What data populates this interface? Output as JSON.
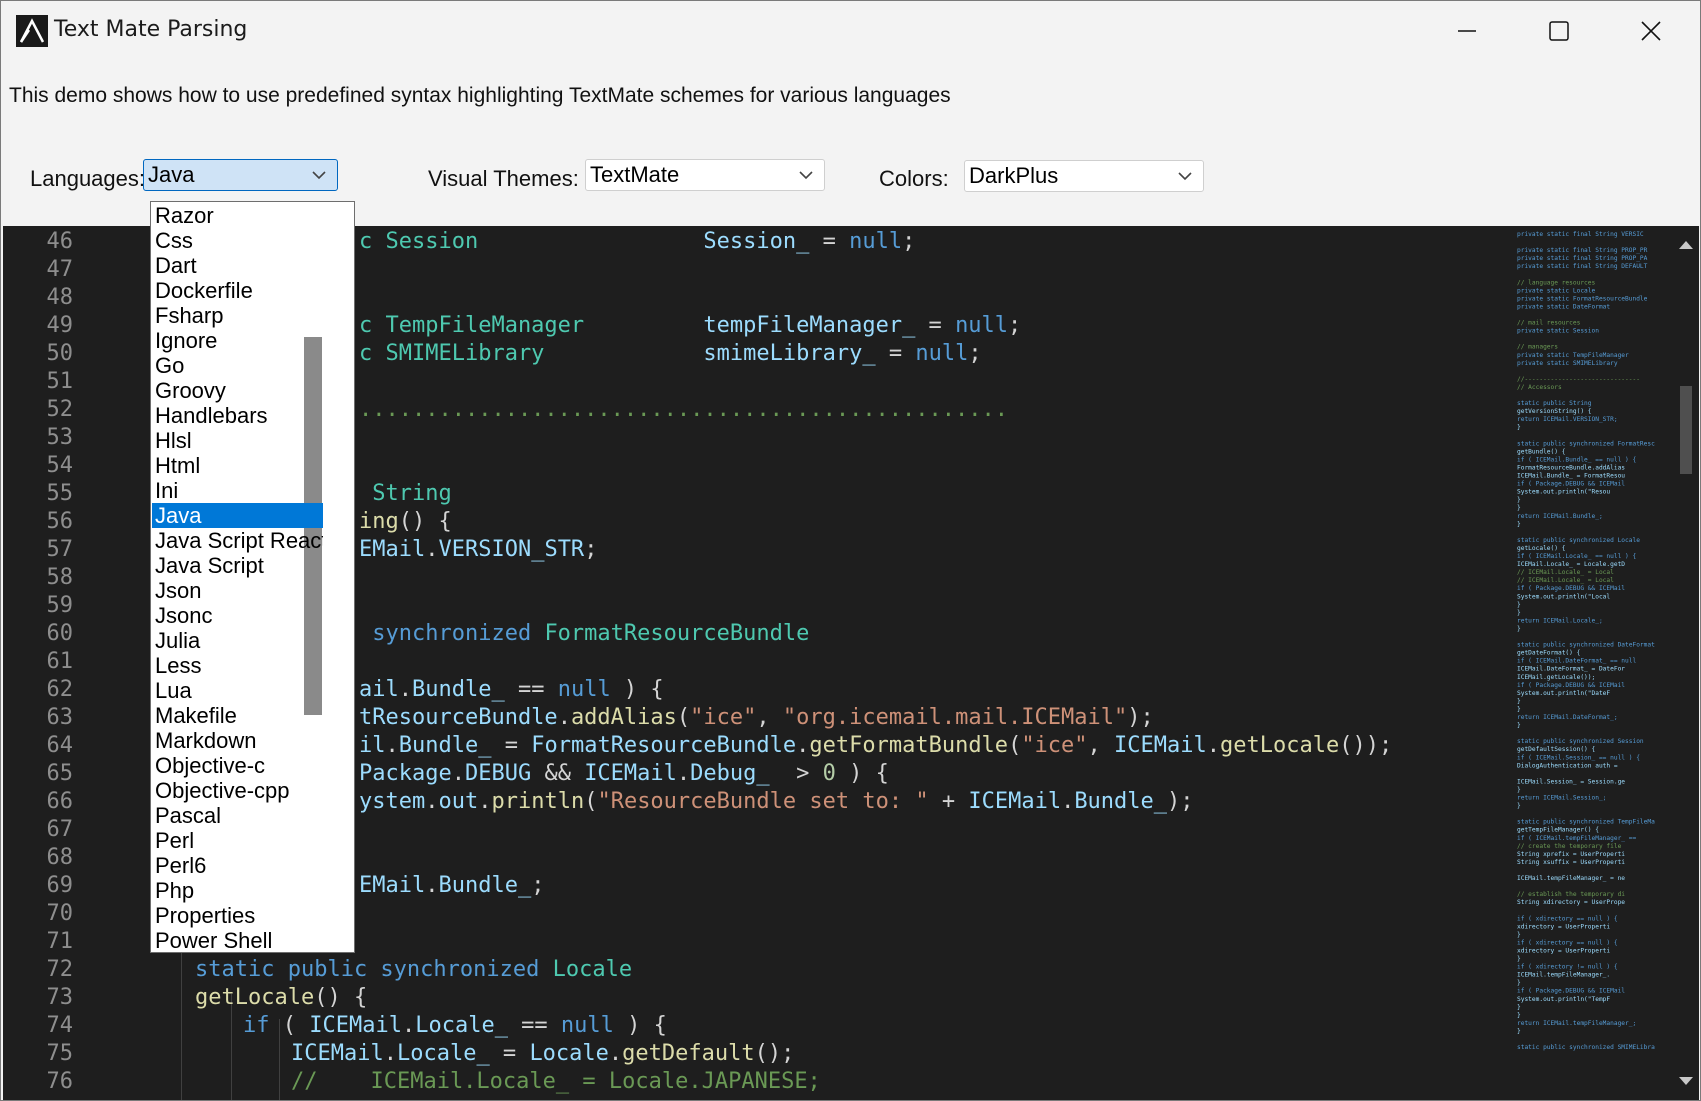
{
  "window": {
    "title": "Text Mate Parsing",
    "description": "This demo shows how to use predefined syntax highlighting TextMate schemes for various languages"
  },
  "controls": {
    "languages": {
      "label": "Languages:",
      "value": "Java"
    },
    "visual_themes": {
      "label": "Visual Themes:",
      "value": "TextMate"
    },
    "colors": {
      "label": "Colors:",
      "value": "DarkPlus"
    }
  },
  "language_options": [
    "Razor",
    "Css",
    "Dart",
    "Dockerfile",
    "Fsharp",
    "Ignore",
    "Go",
    "Groovy",
    "Handlebars",
    "Hlsl",
    "Html",
    "Ini",
    "Java",
    "Java Script React",
    "Java Script",
    "Json",
    "Jsonc",
    "Julia",
    "Less",
    "Lua",
    "Makefile",
    "Markdown",
    "Objective-c",
    "Objective-cpp",
    "Pascal",
    "Perl",
    "Perl6",
    "Php",
    "Properties",
    "Power Shell"
  ],
  "selected_language_index": 12,
  "line_numbers": [
    "46",
    "47",
    "48",
    "49",
    "50",
    "51",
    "52",
    "53",
    "54",
    "55",
    "56",
    "57",
    "58",
    "59",
    "60",
    "61",
    "62",
    "63",
    "64",
    "65",
    "66",
    "67",
    "68",
    "69",
    "70",
    "71",
    "72",
    "73",
    "74",
    "75",
    "76"
  ],
  "code_lines": [
    [
      [
        "ty",
        "c Session"
      ],
      [
        "pl",
        "                 "
      ],
      [
        "id",
        "Session_"
      ],
      [
        "pl",
        " = "
      ],
      [
        "kw",
        "null"
      ],
      [
        "pl",
        ";"
      ]
    ],
    [],
    [],
    [
      [
        "ty",
        "c TempFileManager"
      ],
      [
        "pl",
        "         "
      ],
      [
        "id",
        "tempFileManager_"
      ],
      [
        "pl",
        " = "
      ],
      [
        "kw",
        "null"
      ],
      [
        "pl",
        ";"
      ]
    ],
    [
      [
        "ty",
        "c SMIMELibrary"
      ],
      [
        "pl",
        "            "
      ],
      [
        "id",
        "smimeLibrary_"
      ],
      [
        "pl",
        " = "
      ],
      [
        "kw",
        "null"
      ],
      [
        "pl",
        ";"
      ]
    ],
    [],
    [
      [
        "cm",
        "................................................."
      ]
    ],
    [],
    [],
    [
      [
        "ty",
        " String"
      ]
    ],
    [
      [
        "fn",
        "ing"
      ],
      [
        "pl",
        "() {"
      ]
    ],
    [
      [
        "id",
        "EMail"
      ],
      [
        "pl",
        "."
      ],
      [
        "id",
        "VERSION_STR"
      ],
      [
        "pl",
        ";"
      ]
    ],
    [],
    [],
    [
      [
        "kw",
        " synchronized "
      ],
      [
        "ty",
        "FormatResourceBundle"
      ]
    ],
    [],
    [
      [
        "id",
        "ail"
      ],
      [
        "pl",
        "."
      ],
      [
        "id",
        "Bundle_"
      ],
      [
        "pl",
        " == "
      ],
      [
        "kw",
        "null"
      ],
      [
        "pl",
        " ) {"
      ]
    ],
    [
      [
        "id",
        "tResourceBundle"
      ],
      [
        "pl",
        "."
      ],
      [
        "fn",
        "addAlias"
      ],
      [
        "pl",
        "("
      ],
      [
        "st",
        "\"ice\""
      ],
      [
        "pl",
        ", "
      ],
      [
        "st",
        "\"org.icemail.mail.ICEMail\""
      ],
      [
        "pl",
        ");"
      ]
    ],
    [
      [
        "id",
        "il"
      ],
      [
        "pl",
        "."
      ],
      [
        "id",
        "Bundle_"
      ],
      [
        "pl",
        " = "
      ],
      [
        "id",
        "FormatResourceBundle"
      ],
      [
        "pl",
        "."
      ],
      [
        "fn",
        "getFormatBundle"
      ],
      [
        "pl",
        "("
      ],
      [
        "st",
        "\"ice\""
      ],
      [
        "pl",
        ", "
      ],
      [
        "id",
        "ICEMail"
      ],
      [
        "pl",
        "."
      ],
      [
        "fn",
        "getLocale"
      ],
      [
        "pl",
        "());"
      ]
    ],
    [
      [
        "id",
        "Package"
      ],
      [
        "pl",
        "."
      ],
      [
        "id",
        "DEBUG"
      ],
      [
        "pl",
        " && "
      ],
      [
        "id",
        "ICEMail"
      ],
      [
        "pl",
        "."
      ],
      [
        "id",
        "Debug_"
      ],
      [
        "pl",
        "  > "
      ],
      [
        "nu",
        "0"
      ],
      [
        "pl",
        " ) {"
      ]
    ],
    [
      [
        "id",
        "ystem"
      ],
      [
        "pl",
        "."
      ],
      [
        "id",
        "out"
      ],
      [
        "pl",
        "."
      ],
      [
        "fn",
        "println"
      ],
      [
        "pl",
        "("
      ],
      [
        "st",
        "\"ResourceBundle set to: \""
      ],
      [
        "pl",
        " + "
      ],
      [
        "id",
        "ICEMail"
      ],
      [
        "pl",
        "."
      ],
      [
        "id",
        "Bundle_"
      ],
      [
        "pl",
        ");"
      ]
    ],
    [],
    [],
    [
      [
        "id",
        "EMail"
      ],
      [
        "pl",
        "."
      ],
      [
        "id",
        "Bundle_"
      ],
      [
        "pl",
        ";"
      ]
    ],
    [],
    [],
    [
      [
        "kw",
        "static public synchronized "
      ],
      [
        "ty",
        "Locale"
      ]
    ],
    [
      [
        "fn",
        "getLocale"
      ],
      [
        "pl",
        "() {"
      ]
    ],
    [
      [
        "kw",
        "if"
      ],
      [
        "pl",
        " ( "
      ],
      [
        "id",
        "ICEMail"
      ],
      [
        "pl",
        "."
      ],
      [
        "id",
        "Locale_"
      ],
      [
        "pl",
        " == "
      ],
      [
        "kw",
        "null"
      ],
      [
        "pl",
        " ) {"
      ]
    ],
    [
      [
        "id",
        "ICEMail"
      ],
      [
        "pl",
        "."
      ],
      [
        "id",
        "Locale_"
      ],
      [
        "pl",
        " = "
      ],
      [
        "id",
        "Locale"
      ],
      [
        "pl",
        "."
      ],
      [
        "fn",
        "getDefault"
      ],
      [
        "pl",
        "();"
      ]
    ],
    [
      [
        "cm",
        "//    ICEMail.Locale_ = Locale.JAPANESE;"
      ]
    ]
  ],
  "minimap_lines": [
    "private static final String     VERSIC",
    "",
    "private static final String     PROP_PR",
    "private static final String     PROP_PA",
    "private static final String     DEFAULT",
    "",
    "// language resources",
    "private static Locale",
    "private static FormatResourceBundle",
    "private static DateFormat",
    "",
    "// mail resources",
    "private static Session",
    "",
    "// managers",
    "private static TempFileManager",
    "private static SMIMELibrary",
    "",
    "//-------------------------------",
    "// Accessors",
    "",
    "static public String",
    "getVersionString() {",
    "    return ICEMail.VERSION_STR;",
    "}",
    "",
    "static public synchronized FormatResc",
    "getBundle() {",
    "    if ( ICEMail.Bundle_ == null ) {",
    "        FormatResourceBundle.addAlias",
    "        ICEMail.Bundle_ = FormatResou",
    "        if ( Package.DEBUG && ICEMail",
    "            System.out.println(\"Resou",
    "        }",
    "    }",
    "    return ICEMail.Bundle_;",
    "}",
    "",
    "static public synchronized Locale",
    "getLocale() {",
    "    if ( ICEMail.Locale_ == null ) {",
    "        ICEMail.Locale_ = Locale.getD",
    "//      ICEMail.Locale_ = Local",
    "//      ICEMail.Locale_ = Local",
    "        if ( Package.DEBUG && ICEMail",
    "            System.out.println(\"Local",
    "        }",
    "    }",
    "    return ICEMail.Locale_;",
    "}",
    "",
    "static public synchronized DateFormat",
    "getDateFormat() {",
    "    if ( ICEMail.DateFormat_ == null",
    "        ICEMail.DateFormat_ = DateFor",
    "            ICEMail.getLocale());",
    "        if ( Package.DEBUG && ICEMail",
    "            System.out.println(\"DateF",
    "        }",
    "    }",
    "    return ICEMail.DateFormat_;",
    "}",
    "",
    "static public synchronized Session",
    "getDefaultSession() {",
    "    if ( ICEMail.Session_ == null ) {",
    "        DialogAuthentication auth =",
    "",
    "        ICEMail.Session_ = Session.ge",
    "    }",
    "    return ICEMail.Session_;",
    "}",
    "",
    "static public synchronized TempFileMa",
    "getTempFileManager() {",
    "    if ( ICEMail.tempFileManager_ ==",
    "        // create the temporary file",
    "        String xprefix = UserProperti",
    "        String xsuffix = UserProperti",
    "",
    "        ICEMail.tempFileManager_ = ne",
    "",
    "        // establish the temporary di",
    "        String xdirectory = UserPrope",
    "",
    "        if ( xdirectory == null ) {",
    "            xdirectory = UserProperti",
    "        }",
    "        if ( xdirectory == null ) {",
    "            xdirectory = UserProperti",
    "        }",
    "        if ( xdirectory != null ) {",
    "            ICEMail.tempFileManager_.",
    "        }",
    "        if ( Package.DEBUG && ICEMail",
    "            System.out.println(\"TempF",
    "        }",
    "    }",
    "    return ICEMail.tempFileManager_;",
    "}",
    "",
    "static public synchronized SMIMELibra"
  ],
  "colors": {
    "editor_bg": "#1e1e1e",
    "keyword": "#569cd6",
    "type": "#4ec9b0",
    "identifier": "#9cdcfe",
    "string": "#ce9178",
    "comment": "#6a9955",
    "function": "#dcdcaa",
    "selection": "#0078d7"
  },
  "icons": {
    "app": "app-logo-icon",
    "minimize": "minimize-icon",
    "maximize": "maximize-icon",
    "close": "close-icon",
    "dropdown": "chevron-down-icon"
  }
}
